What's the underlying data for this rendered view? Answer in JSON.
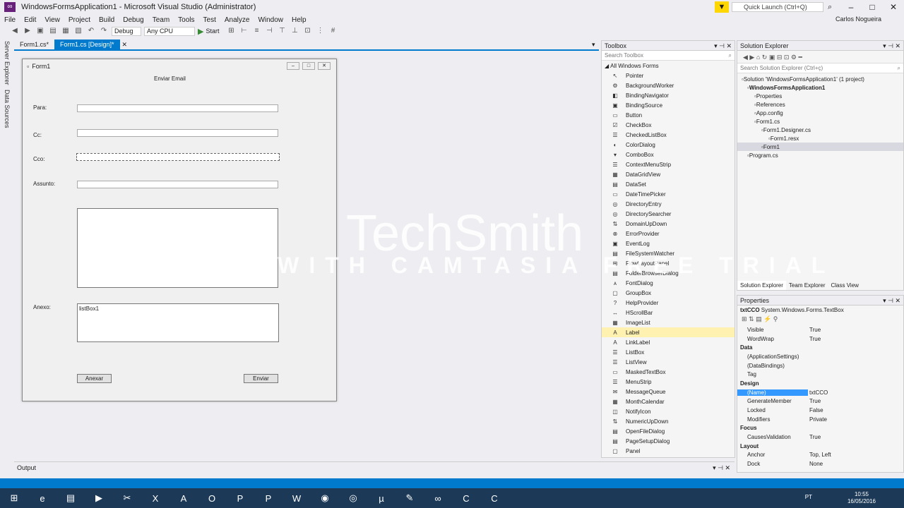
{
  "window": {
    "title": "WindowsFormsApplication1 - Microsoft Visual Studio (Administrator)",
    "user": "Carlos Nogueira",
    "quick_launch": "Quick Launch (Ctrl+Q)"
  },
  "menu": [
    "File",
    "Edit",
    "View",
    "Project",
    "Build",
    "Debug",
    "Team",
    "Tools",
    "Test",
    "Analyze",
    "Window",
    "Help"
  ],
  "toolbar": {
    "config": "Debug",
    "platform": "Any CPU",
    "start": "Start"
  },
  "left_strip": {
    "server_explorer": "Server Explorer",
    "data_sources": "Data Sources"
  },
  "doc_tabs": [
    {
      "label": "Form1.cs*"
    },
    {
      "label": "Form1.cs [Design]*"
    }
  ],
  "form": {
    "title": "Form1",
    "heading": "Enviar Email",
    "labels": {
      "para": "Para:",
      "cc": "Cc:",
      "cco": "Cco:",
      "assunto": "Assunto:",
      "anexo": "Anexo:"
    },
    "listbox": "listBox1",
    "buttons": {
      "anexar": "Anexar",
      "enviar": "Enviar"
    }
  },
  "toolbox": {
    "title": "Toolbox",
    "search": "Search Toolbox",
    "group": "All Windows Forms",
    "items": [
      "Pointer",
      "BackgroundWorker",
      "BindingNavigator",
      "BindingSource",
      "Button",
      "CheckBox",
      "CheckedListBox",
      "ColorDialog",
      "ComboBox",
      "ContextMenuStrip",
      "DataGridView",
      "DataSet",
      "DateTimePicker",
      "DirectoryEntry",
      "DirectorySearcher",
      "DomainUpDown",
      "ErrorProvider",
      "EventLog",
      "FileSystemWatcher",
      "FlowLayoutPanel",
      "FolderBrowserDialog",
      "FontDialog",
      "GroupBox",
      "HelpProvider",
      "HScrollBar",
      "ImageList",
      "Label",
      "LinkLabel",
      "ListBox",
      "ListView",
      "MaskedTextBox",
      "MenuStrip",
      "MessageQueue",
      "MonthCalendar",
      "NotifyIcon",
      "NumericUpDown",
      "OpenFileDialog",
      "PageSetupDialog",
      "Panel"
    ],
    "selected": "Label"
  },
  "solution_explorer": {
    "title": "Solution Explorer",
    "search": "Search Solution Explorer (Ctrl+ç)",
    "items": [
      "Solution 'WindowsFormsApplication1' (1 project)",
      "WindowsFormsApplication1",
      "Properties",
      "References",
      "App.config",
      "Form1.cs",
      "Form1.Designer.cs",
      "Form1.resx",
      "Form1",
      "Program.cs"
    ],
    "tabs": [
      "Solution Explorer",
      "Team Explorer",
      "Class View"
    ]
  },
  "properties": {
    "title": "Properties",
    "object": "txtCCO",
    "type": "System.Windows.Forms.TextBox",
    "rows": [
      {
        "name": "Visible",
        "value": "True",
        "cat": false
      },
      {
        "name": "WordWrap",
        "value": "True",
        "cat": false
      },
      {
        "name": "Data",
        "value": "",
        "cat": true
      },
      {
        "name": "(ApplicationSettings)",
        "value": "",
        "cat": false
      },
      {
        "name": "(DataBindings)",
        "value": "",
        "cat": false
      },
      {
        "name": "Tag",
        "value": "",
        "cat": false
      },
      {
        "name": "Design",
        "value": "",
        "cat": true
      },
      {
        "name": "(Name)",
        "value": "txtCCO",
        "cat": false
      },
      {
        "name": "GenerateMember",
        "value": "True",
        "cat": false
      },
      {
        "name": "Locked",
        "value": "False",
        "cat": false
      },
      {
        "name": "Modifiers",
        "value": "Private",
        "cat": false
      },
      {
        "name": "Focus",
        "value": "",
        "cat": true
      },
      {
        "name": "CausesValidation",
        "value": "True",
        "cat": false
      },
      {
        "name": "Layout",
        "value": "",
        "cat": true
      },
      {
        "name": "Anchor",
        "value": "Top, Left",
        "cat": false
      },
      {
        "name": "Dock",
        "value": "None",
        "cat": false
      }
    ]
  },
  "output": {
    "title": "Output"
  },
  "taskbar": {
    "time": "10:55",
    "date": "16/05/2016",
    "lang": "PT"
  },
  "watermark": {
    "line1": "TechSmith",
    "line2": "MADE WITH CAMTASIA FREE TRIAL"
  }
}
